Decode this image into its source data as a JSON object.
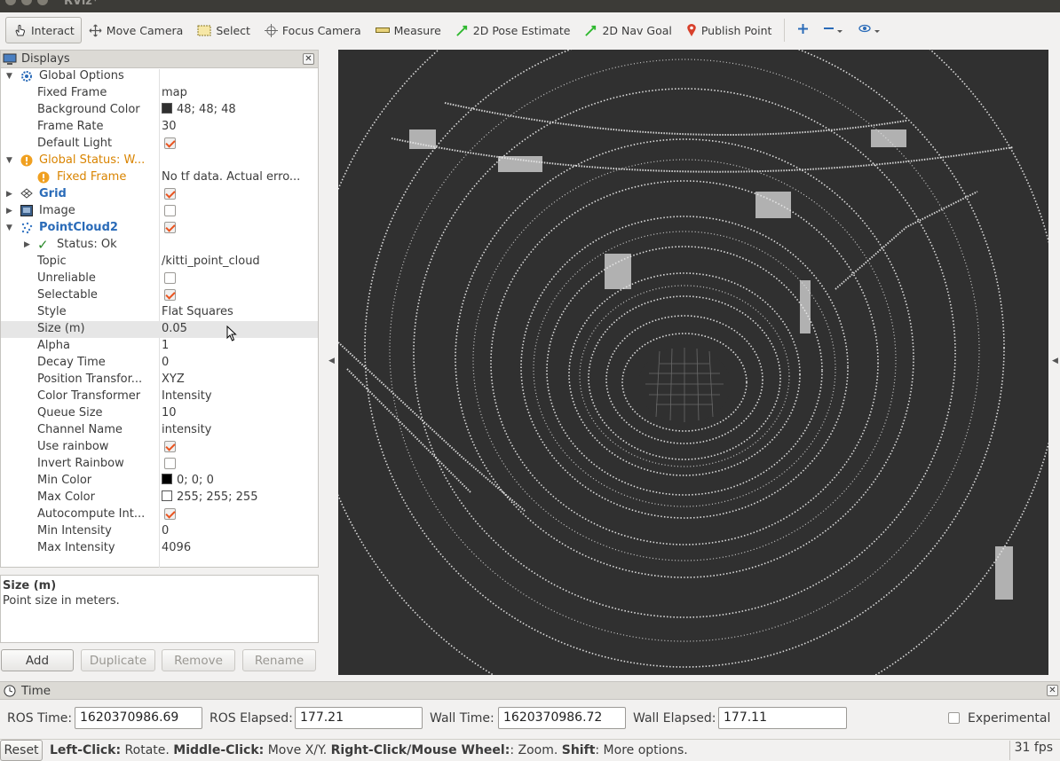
{
  "window": {
    "title": "RViz*"
  },
  "toolbar": {
    "interact": "Interact",
    "move_camera": "Move Camera",
    "select": "Select",
    "focus_camera": "Focus Camera",
    "measure": "Measure",
    "pose_estimate": "2D Pose Estimate",
    "nav_goal": "2D Nav Goal",
    "publish_point": "Publish Point"
  },
  "displays": {
    "title": "Displays",
    "global_options": "Global Options",
    "fixed_frame_label": "Fixed Frame",
    "fixed_frame_value": "map",
    "background_color_label": "Background Color",
    "background_color_value": "48; 48; 48",
    "frame_rate_label": "Frame Rate",
    "frame_rate_value": "30",
    "default_light_label": "Default Light",
    "global_status": "Global Status: W...",
    "gs_fixed_frame": "Fixed Frame",
    "gs_fixed_frame_value": "No tf data.  Actual erro...",
    "grid": "Grid",
    "image": "Image",
    "pointcloud2": "PointCloud2",
    "status_ok": "Status: Ok",
    "props": [
      {
        "label": "Topic",
        "value": "/kitti_point_cloud"
      },
      {
        "label": "Unreliable",
        "value": ""
      },
      {
        "label": "Selectable",
        "value": ""
      },
      {
        "label": "Style",
        "value": "Flat Squares"
      },
      {
        "label": "Size (m)",
        "value": "0.05"
      },
      {
        "label": "Alpha",
        "value": "1"
      },
      {
        "label": "Decay Time",
        "value": "0"
      },
      {
        "label": "Position Transfor...",
        "value": "XYZ"
      },
      {
        "label": "Color Transformer",
        "value": "Intensity"
      },
      {
        "label": "Queue Size",
        "value": "10"
      },
      {
        "label": "Channel Name",
        "value": "intensity"
      },
      {
        "label": "Use rainbow",
        "value": ""
      },
      {
        "label": "Invert Rainbow",
        "value": ""
      },
      {
        "label": "Min Color",
        "value": "0; 0; 0"
      },
      {
        "label": "Max Color",
        "value": "255; 255; 255"
      },
      {
        "label": "Autocompute Int...",
        "value": ""
      },
      {
        "label": "Min Intensity",
        "value": "0"
      },
      {
        "label": "Max Intensity",
        "value": "4096"
      }
    ],
    "checkboxes": {
      "default_light": true,
      "grid": true,
      "image": false,
      "pointcloud2": true,
      "unreliable": false,
      "selectable": true,
      "use_rainbow": true,
      "invert_rainbow": false,
      "autocompute": true
    },
    "colors": {
      "background": "#303030",
      "min_color": "#000000",
      "max_color": "#ffffff"
    }
  },
  "description": {
    "title": "Size (m)",
    "text": "Point size in meters."
  },
  "buttons": {
    "add": "Add",
    "duplicate": "Duplicate",
    "remove": "Remove",
    "rename": "Rename"
  },
  "time": {
    "title": "Time",
    "ros_time_label": "ROS Time:",
    "ros_time": "1620370986.69",
    "ros_elapsed_label": "ROS Elapsed:",
    "ros_elapsed": "177.21",
    "wall_time_label": "Wall Time:",
    "wall_time": "1620370986.72",
    "wall_elapsed_label": "Wall Elapsed:",
    "wall_elapsed": "177.11",
    "experimental_label": "Experimental"
  },
  "status": {
    "reset": "Reset",
    "lc": "Left-Click:",
    "lc_t": " Rotate. ",
    "mc": "Middle-Click:",
    "mc_t": " Move X/Y. ",
    "rc": "Right-Click/Mouse Wheel:",
    "rc_t": ": Zoom. ",
    "sh": "Shift",
    "sh_t": ": More options.",
    "fps": "31 fps"
  }
}
